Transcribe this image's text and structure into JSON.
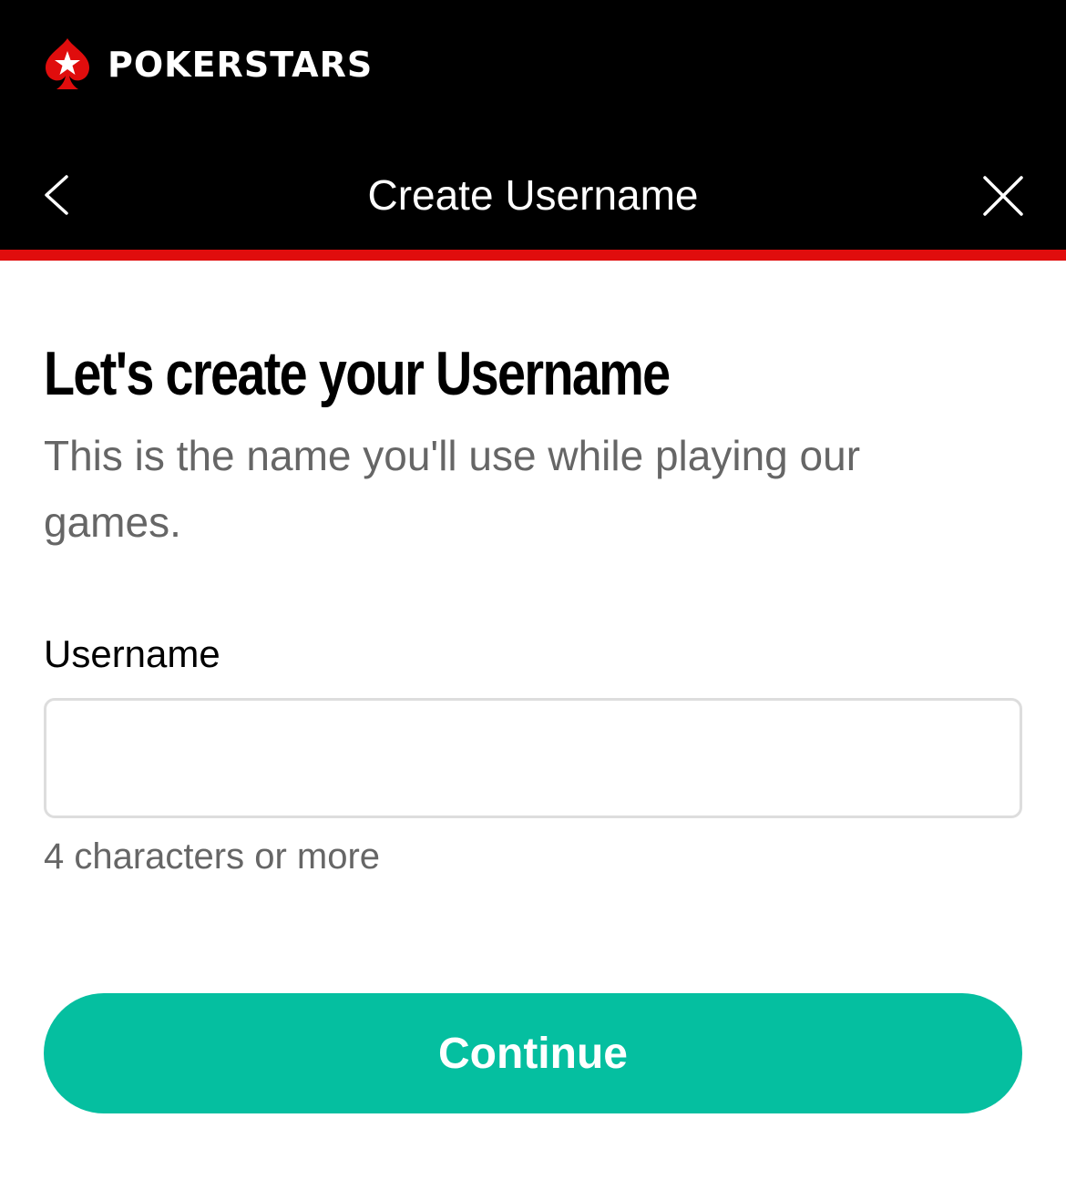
{
  "header": {
    "brand": "POKERSTARS",
    "logo_icon": "spade-star-icon",
    "nav": {
      "title": "Create Username",
      "back_icon": "chevron-left-icon",
      "close_icon": "close-icon"
    }
  },
  "main": {
    "headline": "Let's create your Username",
    "subtitle": "This is the name you'll use while playing our games.",
    "username_field": {
      "label": "Username",
      "value": "",
      "placeholder": "",
      "hint": "4 characters or more"
    },
    "continue_label": "Continue"
  },
  "colors": {
    "header_bg": "#000000",
    "accent_red": "#e00d0d",
    "button_teal": "#05bfa0",
    "secondary_text": "#666666",
    "input_border": "#dddddd"
  }
}
